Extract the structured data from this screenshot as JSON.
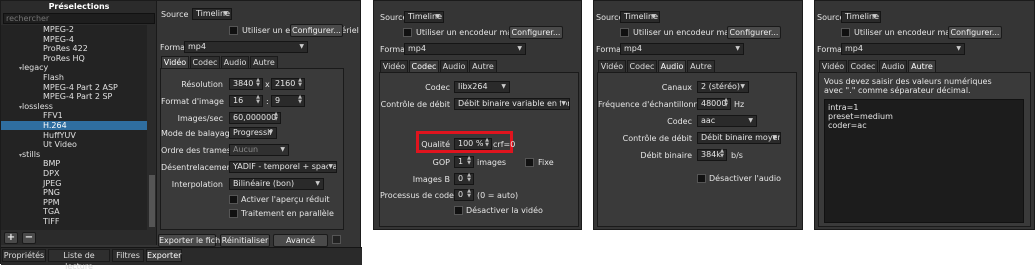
{
  "presets": {
    "title": "Préselections",
    "search_placeholder": "rechercher",
    "items": [
      {
        "label": "MPEG-2",
        "level": 2
      },
      {
        "label": "MPEG-4",
        "level": 2
      },
      {
        "label": "ProRes 422",
        "level": 2
      },
      {
        "label": "ProRes HQ",
        "level": 2
      },
      {
        "label": "legacy",
        "level": 1,
        "group": true
      },
      {
        "label": "Flash",
        "level": 2
      },
      {
        "label": "MPEG-4 Part 2 ASP",
        "level": 2
      },
      {
        "label": "MPEG-4 Part 2 SP",
        "level": 2
      },
      {
        "label": "lossless",
        "level": 1,
        "group": true
      },
      {
        "label": "FFV1",
        "level": 2
      },
      {
        "label": "H.264",
        "level": 2,
        "selected": true
      },
      {
        "label": "HuffYUV",
        "level": 2
      },
      {
        "label": "Ut Video",
        "level": 2
      },
      {
        "label": "stills",
        "level": 1,
        "group": true
      },
      {
        "label": "BMP",
        "level": 2
      },
      {
        "label": "DPX",
        "level": 2
      },
      {
        "label": "JPEG",
        "level": 2
      },
      {
        "label": "PNG",
        "level": 2
      },
      {
        "label": "PPM",
        "level": 2
      },
      {
        "label": "TGA",
        "level": 2
      },
      {
        "label": "TIFF",
        "level": 2
      }
    ],
    "add_symbol": "+",
    "remove_symbol": "−"
  },
  "bottom_tabs": [
    "Propriétés",
    "Liste de lecture",
    "Filtres",
    "Exporter"
  ],
  "common": {
    "source_label": "Source",
    "source_value": "Timeline",
    "hw_encoder_label": "Utiliser un encodeur matériel",
    "configure_button": "Configurer...",
    "format_label": "Format",
    "format_value": "mp4",
    "tabs": [
      "Vidéo",
      "Codec",
      "Audio",
      "Autre"
    ]
  },
  "video": {
    "resolution_label": "Résolution",
    "res_w": "3840",
    "res_x": "x",
    "res_h": "2160",
    "aspect_label": "Format d'image",
    "aspect_w": "16",
    "aspect_sep": ":",
    "aspect_h": "9",
    "fps_label": "Images/sec",
    "fps_value": "60,000000",
    "scan_label": "Mode de balayage",
    "scan_value": "Progressif",
    "field_order_label": "Ordre des trames",
    "field_order_value": "Aucun",
    "deinterlace_label": "Désentrelacement",
    "deinterlace_value": "YADIF - temporel + spacial (mei",
    "interp_label": "Interpolation",
    "interp_value": "Bilinéaire (bon)",
    "reduced_preview_label": "Activer l'aperçu réduit",
    "parallel_label": "Traitement en parallèle",
    "export_button": "Exporter le fichier",
    "reset_button": "Réinitialiser",
    "advanced_button": "Avancé"
  },
  "codec": {
    "codec_label": "Codec",
    "codec_value": "libx264",
    "ratecontrol_label": "Contrôle de débit",
    "ratecontrol_value": "Débit binaire variable en fonction",
    "quality_label": "Qualité",
    "quality_value": "100 %",
    "crf_text": "crf=0",
    "gop_label": "GOP",
    "gop_value": "1",
    "gop_unit": "images",
    "fixed_label": "Fixe",
    "bframes_label": "Images B",
    "bframes_value": "0",
    "threads_label": "Processus de codec",
    "threads_value": "0",
    "threads_note": "(0 = auto)",
    "disable_video_label": "Désactiver la vidéo",
    "highlight_color": "#e0141e"
  },
  "audio": {
    "channels_label": "Canaux",
    "channels_value": "2 (stéréo)",
    "samplerate_label": "Fréquence d'échantillonnage",
    "samplerate_value": "48000",
    "samplerate_unit": "Hz",
    "codec_label": "Codec",
    "codec_value": "aac",
    "ratecontrol_label": "Contrôle de débit",
    "ratecontrol_value": "Débit binaire moyen",
    "bitrate_label": "Débit binaire",
    "bitrate_value": "384k",
    "bitrate_unit": "b/s",
    "disable_audio_label": "Désactiver l'audio"
  },
  "other": {
    "note": "Vous devez saisir des valeurs numériques avec \".\" comme séparateur décimal.",
    "line1": "intra=1",
    "line2": "preset=medium",
    "line3": "coder=ac"
  }
}
